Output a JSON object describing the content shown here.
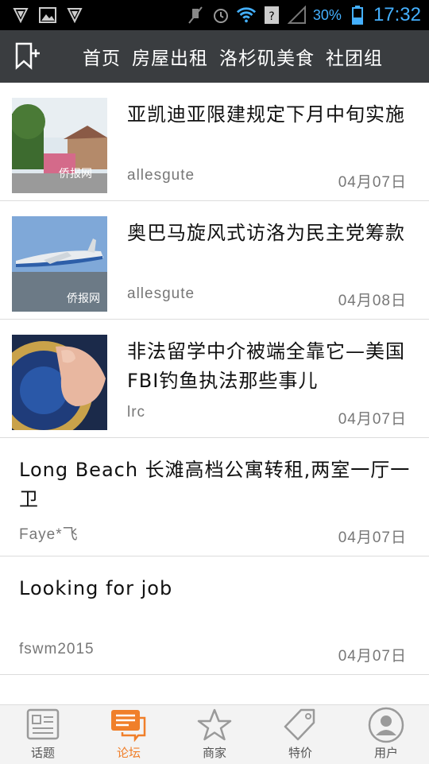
{
  "status_bar": {
    "battery": "30%",
    "time": "17:32"
  },
  "top_nav": {
    "tabs": [
      "首页",
      "房屋出租",
      "洛杉矶美食",
      "社团组"
    ]
  },
  "posts": [
    {
      "title": "亚凯迪亚限建规定下月中旬实施",
      "author": "allesgute",
      "date": "04月07日",
      "thumb": "street-scene"
    },
    {
      "title": "奥巴马旋风式访洛为民主党筹款",
      "author": "allesgute",
      "date": "04月08日",
      "thumb": "air-force-one"
    },
    {
      "title": "非法留学中介被端全靠它—美国FBI钓鱼执法那些事儿",
      "author": "lrc",
      "date": "04月07日",
      "thumb": "fbi-seal"
    },
    {
      "title": "Long Beach 长滩高档公寓转租,两室一厅一卫",
      "author": "Faye*飞",
      "date": "04月07日"
    },
    {
      "title": "Looking for job",
      "author": "fswm2015",
      "date": "04月07日"
    }
  ],
  "bottom_nav": {
    "items": [
      {
        "label": "话题",
        "icon": "topic-icon"
      },
      {
        "label": "论坛",
        "icon": "forum-icon"
      },
      {
        "label": "商家",
        "icon": "star-icon"
      },
      {
        "label": "特价",
        "icon": "tag-icon"
      },
      {
        "label": "用户",
        "icon": "user-icon"
      }
    ],
    "active_index": 1
  },
  "colors": {
    "accent": "#f07f2a",
    "nav_bg": "#3a3d40",
    "status_text": "#44b0ff"
  }
}
